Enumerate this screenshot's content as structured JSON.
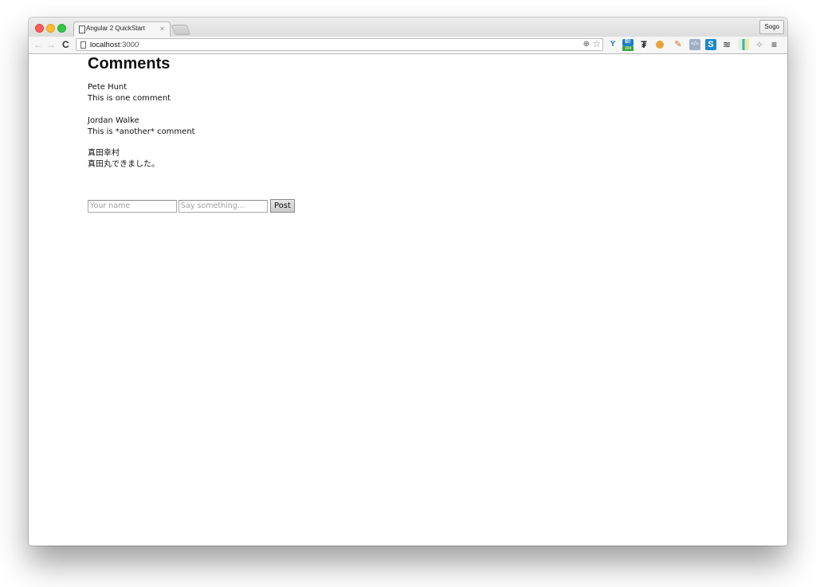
{
  "browser": {
    "tab": {
      "title": "Angular 2 QuickStart",
      "close_glyph": "×"
    },
    "profile_button": "Sogo",
    "nav": {
      "back": "←",
      "forward": "→",
      "reload": "C"
    },
    "address_bar": {
      "host": "localhost",
      "port": ":3000"
    },
    "omnibox_icons": {
      "zoom": "⊕",
      "bookmark": "☆"
    },
    "extensions": [
      {
        "name": "vue-devtools",
        "glyph": "Y"
      },
      {
        "name": "hatena-bookmark",
        "glyph": "B!",
        "badge": "104"
      },
      {
        "name": "traffic-light",
        "glyph": "₮"
      },
      {
        "name": "cookie",
        "glyph": ""
      },
      {
        "name": "pencil",
        "glyph": "✎"
      },
      {
        "name": "code-viewer",
        "glyph": "</>"
      },
      {
        "name": "s-extension",
        "glyph": "S"
      },
      {
        "name": "jquery",
        "glyph": "≋"
      },
      {
        "name": "map-extension",
        "glyph": ""
      },
      {
        "name": "puzzle",
        "glyph": "✧"
      }
    ],
    "menu_glyph": "≡"
  },
  "page": {
    "title": "Comments",
    "comments": [
      {
        "author": "Pete Hunt",
        "text": "This is one comment"
      },
      {
        "author": "Jordan Walke",
        "text": "This is *another* comment"
      },
      {
        "author": "真田幸村",
        "text": "真田丸できました。"
      }
    ],
    "form": {
      "name_placeholder": "Your name",
      "name_value": "",
      "text_placeholder": "Say something...",
      "text_value": "",
      "submit_label": "Post"
    }
  }
}
